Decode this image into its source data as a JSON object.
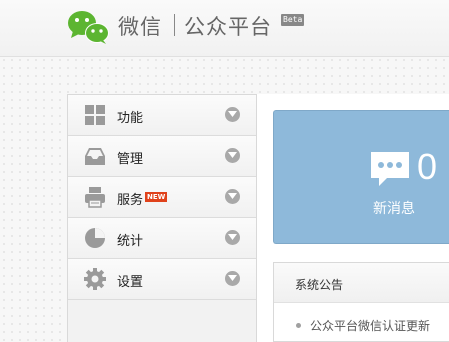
{
  "header": {
    "brand_name": "微信",
    "brand_sub": "公众平台",
    "beta_badge": "Beta"
  },
  "sidebar": {
    "items": [
      {
        "label": "功能",
        "icon": "grid-icon"
      },
      {
        "label": "管理",
        "icon": "inbox-icon"
      },
      {
        "label": "服务",
        "icon": "printer-icon",
        "badge": "NEW"
      },
      {
        "label": "统计",
        "icon": "pie-chart-icon"
      },
      {
        "label": "设置",
        "icon": "gear-icon"
      }
    ]
  },
  "main": {
    "messages": {
      "count": "0",
      "label": "新消息",
      "color": "#8eb9da"
    },
    "notice": {
      "title": "系统公告",
      "items": [
        "公众平台微信认证更新"
      ]
    }
  },
  "colors": {
    "wechat_green": "#5cb531",
    "new_badge": "#e0421b",
    "chevron": "#a9a9a9"
  }
}
